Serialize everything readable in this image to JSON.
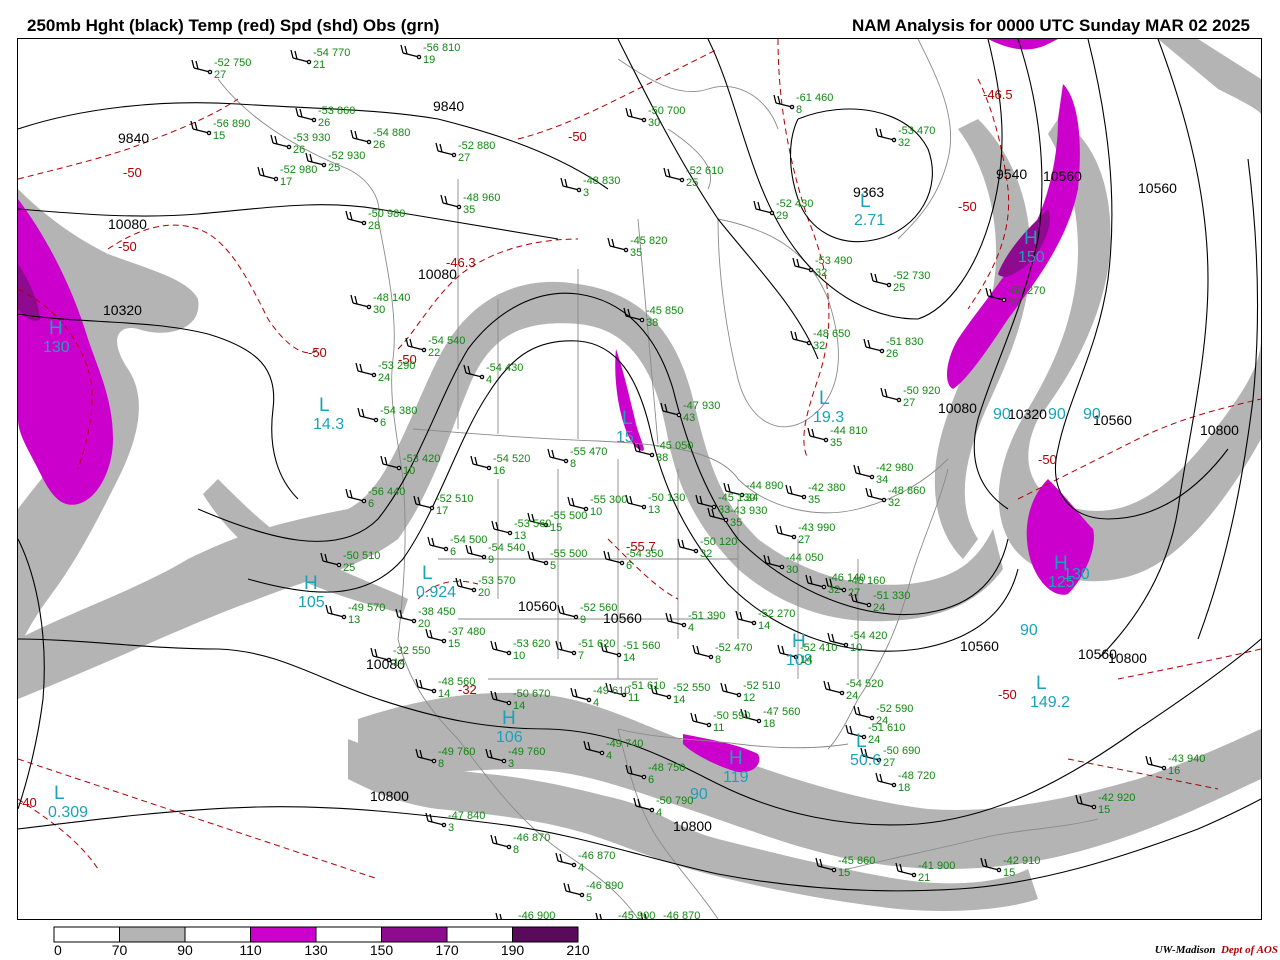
{
  "header": {
    "left_title": "250mb Hght (black) Temp (red) Spd (shd) Obs (grn)",
    "right_title": "NAM Analysis for 0000 UTC Sunday  MAR 02 2025"
  },
  "credit": {
    "org": "UW-Madison",
    "dept": "Dept of AOS"
  },
  "colors": {
    "spd_70_90": "#b4b4b4",
    "spd_110_130": "#cc00cc",
    "spd_150_170": "#8e0a8e",
    "spd_190_210": "#5a0a5a",
    "height_contour": "#000000",
    "temp_contour": "#b00000",
    "obs_text": "#118811",
    "center_label": "#19a3b8"
  },
  "legend": {
    "ticks": [
      "0",
      "70",
      "90",
      "110",
      "130",
      "150",
      "170",
      "190",
      "210"
    ],
    "bins": [
      {
        "color": "#ffffff"
      },
      {
        "color": "#b4b4b4"
      },
      {
        "color": "#ffffff"
      },
      {
        "color": "#cc00cc"
      },
      {
        "color": "#ffffff"
      },
      {
        "color": "#8e0a8e"
      },
      {
        "color": "#ffffff"
      },
      {
        "color": "#5a0a5a"
      }
    ]
  },
  "height_labels": [
    "9840",
    "9840",
    "10080",
    "10320",
    "10080",
    "9540",
    "9363",
    "10560",
    "10080",
    "10320",
    "10560",
    "10800",
    "10560",
    "10560",
    "10800",
    "10800",
    "10800",
    "10560",
    "10560",
    "10080",
    "10560"
  ],
  "temp_labels": [
    "-50",
    "-50",
    "-50",
    "-50",
    "-46.3",
    "-50",
    "-50",
    "-46.5",
    "-50",
    "-55.7",
    "-50",
    "-32",
    "-40"
  ],
  "centers": [
    {
      "letter": "L",
      "value": "14.3"
    },
    {
      "letter": "L",
      "value": "19.3"
    },
    {
      "letter": "L",
      "value": "2.71"
    },
    {
      "letter": "H",
      "value": "105"
    },
    {
      "letter": "L",
      "value": "0.924"
    },
    {
      "letter": "H",
      "value": "106"
    },
    {
      "letter": "L",
      "value": "0.309"
    },
    {
      "letter": "L",
      "value": "50.6"
    },
    {
      "letter": "L",
      "value": "149.2"
    },
    {
      "letter": "H",
      "value": "125"
    },
    {
      "letter": "H",
      "value": "119"
    },
    {
      "letter": "H",
      "value": "130"
    },
    {
      "letter": "H",
      "value": "150"
    },
    {
      "letter": "H",
      "value": "108"
    },
    {
      "letter": "L",
      "value": "15"
    }
  ],
  "speed_labels": [
    "90",
    "90",
    "90",
    "90",
    "90",
    "130"
  ],
  "observations": [
    {
      "t": "-52",
      "h": "750",
      "d": "27"
    },
    {
      "t": "-54",
      "h": "770",
      "d": "21"
    },
    {
      "t": "-56",
      "h": "810",
      "d": "19"
    },
    {
      "t": "-56",
      "h": "890",
      "d": "15"
    },
    {
      "t": "-53",
      "h": "860",
      "d": "26"
    },
    {
      "t": "-54",
      "h": "880",
      "d": "26"
    },
    {
      "t": "-53",
      "h": "930",
      "d": "26"
    },
    {
      "t": "-52",
      "h": "930",
      "d": "25"
    },
    {
      "t": "-52",
      "h": "980",
      "d": "17"
    },
    {
      "t": "-52",
      "h": "880",
      "d": "27"
    },
    {
      "t": "-50",
      "h": "700",
      "d": "30"
    },
    {
      "t": "-52",
      "h": "610",
      "d": "25"
    },
    {
      "t": "-61",
      "h": "460",
      "d": "8"
    },
    {
      "t": "-53",
      "h": "470",
      "d": "32"
    },
    {
      "t": "-48",
      "h": "830",
      "d": "3"
    },
    {
      "t": "-48",
      "h": "960",
      "d": "35"
    },
    {
      "t": "-50",
      "h": "980",
      "d": "28"
    },
    {
      "t": "-52",
      "h": "430",
      "d": "29"
    },
    {
      "t": "-45",
      "h": "820",
      "d": "35"
    },
    {
      "t": "-53",
      "h": "490",
      "d": "32"
    },
    {
      "t": "-52",
      "h": "730",
      "d": "25"
    },
    {
      "t": "-56",
      "h": "270",
      "d": "26"
    },
    {
      "t": "-48",
      "h": "140",
      "d": "30"
    },
    {
      "t": "-45",
      "h": "850",
      "d": "38"
    },
    {
      "t": "-48",
      "h": "650",
      "d": "32"
    },
    {
      "t": "-51",
      "h": "830",
      "d": "26"
    },
    {
      "t": "-54",
      "h": "540",
      "d": "22"
    },
    {
      "t": "-53",
      "h": "290",
      "d": "24"
    },
    {
      "t": "-54",
      "h": "430",
      "d": "4"
    },
    {
      "t": "-54",
      "h": "380",
      "d": "6"
    },
    {
      "t": "-47",
      "h": "930",
      "d": "43"
    },
    {
      "t": "-44",
      "h": "810",
      "d": "35"
    },
    {
      "t": "-50",
      "h": "920",
      "d": "27"
    },
    {
      "t": "-53",
      "h": "420",
      "d": "10"
    },
    {
      "t": "-54",
      "h": "520",
      "d": "16"
    },
    {
      "t": "-55",
      "h": "470",
      "d": "8"
    },
    {
      "t": "-45",
      "h": "050",
      "d": "38"
    },
    {
      "t": "-56",
      "h": "440",
      "d": "6"
    },
    {
      "t": "-52",
      "h": "510",
      "d": "17"
    },
    {
      "t": "-55",
      "h": "500",
      "d": "15"
    },
    {
      "t": "-53",
      "h": "560",
      "d": "13"
    },
    {
      "t": "-55",
      "h": "300",
      "d": "10"
    },
    {
      "t": "-50",
      "h": "130",
      "d": "13"
    },
    {
      "t": "-45",
      "h": "130",
      "d": "33"
    },
    {
      "t": "-44",
      "h": "890",
      "d": "34"
    },
    {
      "t": "-42",
      "h": "380",
      "d": "35"
    },
    {
      "t": "-42",
      "h": "980",
      "d": "34"
    },
    {
      "t": "-48",
      "h": "860",
      "d": "32"
    },
    {
      "t": "-43",
      "h": "930",
      "d": "35"
    },
    {
      "t": "-54",
      "h": "500",
      "d": "6"
    },
    {
      "t": "-54",
      "h": "540",
      "d": "9"
    },
    {
      "t": "-50",
      "h": "510",
      "d": "25"
    },
    {
      "t": "-53",
      "h": "570",
      "d": "20"
    },
    {
      "t": "-55",
      "h": "500",
      "d": "5"
    },
    {
      "t": "-54",
      "h": "350",
      "d": "6"
    },
    {
      "t": "-50",
      "h": "120",
      "d": "32"
    },
    {
      "t": "-43",
      "h": "990",
      "d": "27"
    },
    {
      "t": "-44",
      "h": "050",
      "d": "30"
    },
    {
      "t": "-46",
      "h": "140",
      "d": "32"
    },
    {
      "t": "-48",
      "h": "160",
      "d": "27"
    },
    {
      "t": "-51",
      "h": "330",
      "d": "24"
    },
    {
      "t": "-49",
      "h": "570",
      "d": "13"
    },
    {
      "t": "-38",
      "h": "450",
      "d": "20"
    },
    {
      "t": "-52",
      "h": "560",
      "d": "9"
    },
    {
      "t": "-51",
      "h": "390",
      "d": "4"
    },
    {
      "t": "-37",
      "h": "480",
      "d": "15"
    },
    {
      "t": "-53",
      "h": "620",
      "d": "10"
    },
    {
      "t": "-51",
      "h": "620",
      "d": "7"
    },
    {
      "t": "-51",
      "h": "560",
      "d": "14"
    },
    {
      "t": "-52",
      "h": "470",
      "d": "8"
    },
    {
      "t": "-52",
      "h": "270",
      "d": "14"
    },
    {
      "t": "-52",
      "h": "410",
      "d": "14"
    },
    {
      "t": "-54",
      "h": "420",
      "d": "10"
    },
    {
      "t": "-32",
      "h": "550",
      "d": "14"
    },
    {
      "t": "-48",
      "h": "560",
      "d": "14"
    },
    {
      "t": "-50",
      "h": "670",
      "d": "14"
    },
    {
      "t": "-49",
      "h": "610",
      "d": "4"
    },
    {
      "t": "-51",
      "h": "610",
      "d": "11"
    },
    {
      "t": "-52",
      "h": "550",
      "d": "14"
    },
    {
      "t": "-52",
      "h": "510",
      "d": "12"
    },
    {
      "t": "-47",
      "h": "560",
      "d": "18"
    },
    {
      "t": "-54",
      "h": "520",
      "d": "24"
    },
    {
      "t": "-52",
      "h": "590",
      "d": "24"
    },
    {
      "t": "-51",
      "h": "610",
      "d": "24"
    },
    {
      "t": "-50",
      "h": "690",
      "d": "27"
    },
    {
      "t": "-48",
      "h": "720",
      "d": "18"
    },
    {
      "t": "-49",
      "h": "760",
      "d": "8"
    },
    {
      "t": "-49",
      "h": "760",
      "d": "3"
    },
    {
      "t": "-49",
      "h": "740",
      "d": "4"
    },
    {
      "t": "-48",
      "h": "750",
      "d": "6"
    },
    {
      "t": "-50",
      "h": "590",
      "d": "11"
    },
    {
      "t": "-50",
      "h": "790",
      "d": "4"
    },
    {
      "t": "-47",
      "h": "840",
      "d": "3"
    },
    {
      "t": "-46",
      "h": "870",
      "d": "8"
    },
    {
      "t": "-46",
      "h": "870",
      "d": "4"
    },
    {
      "t": "-46",
      "h": "890",
      "d": "5"
    },
    {
      "t": "-46",
      "h": "900",
      "d": "5"
    },
    {
      "t": "-45",
      "h": "900",
      "d": "5"
    },
    {
      "t": "-46",
      "h": "870",
      "d": "5"
    },
    {
      "t": "-45",
      "h": "860",
      "d": "15"
    },
    {
      "t": "-41",
      "h": "900",
      "d": "21"
    },
    {
      "t": "-42",
      "h": "910",
      "d": "15"
    },
    {
      "t": "-42",
      "h": "920",
      "d": "15"
    },
    {
      "t": "-43",
      "h": "940",
      "d": "16"
    }
  ]
}
